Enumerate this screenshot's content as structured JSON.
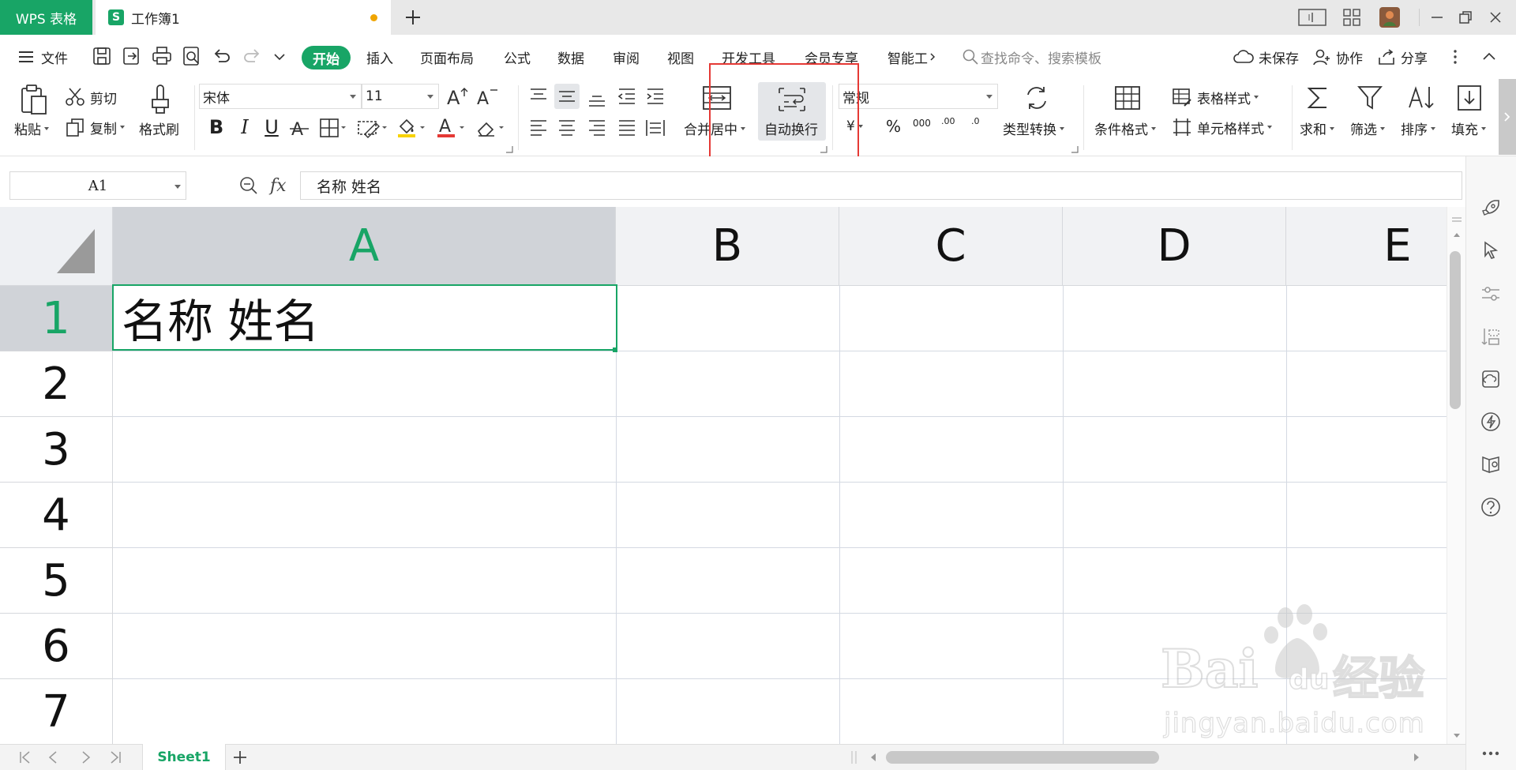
{
  "titlebar": {
    "app_tab": "WPS 表格",
    "doc_tab": "工作簿1",
    "doc_icon": "S"
  },
  "menu": {
    "file": "文件",
    "active": "开始",
    "items": [
      "插入",
      "页面布局",
      "公式",
      "数据",
      "审阅",
      "视图",
      "开发工具",
      "会员专享",
      "智能工"
    ],
    "search_placeholder": "查找命令、搜索模板",
    "unsaved": "未保存",
    "collaborate": "协作",
    "share": "分享"
  },
  "ribbon": {
    "paste": "粘贴",
    "cut": "剪切",
    "copy": "复制",
    "format_painter": "格式刷",
    "font_name": "宋体",
    "font_size": "11",
    "merge_center": "合并居中",
    "wrap_text": "自动换行",
    "number_format": "常规",
    "currency": "¥",
    "percent": "%",
    "thousands": "000",
    "inc_decimal": ".00",
    "dec_decimal": ".0",
    "type_convert": "类型转换",
    "conditional_format": "条件格式",
    "table_style": "表格样式",
    "cell_style": "单元格样式",
    "sum": "求和",
    "filter": "筛选",
    "sort": "排序",
    "fill": "填充",
    "bold": "B",
    "italic": "I",
    "underline": "U",
    "font_color_letter": "A"
  },
  "formula_bar": {
    "cell_ref": "A1",
    "fx": "fx",
    "content": "名称  姓名"
  },
  "sheet": {
    "columns": [
      "A",
      "B",
      "C",
      "D",
      "E"
    ],
    "rows": [
      "1",
      "2",
      "3",
      "4",
      "5",
      "6",
      "7"
    ],
    "cell_a1": "名称  姓名",
    "tab": "Sheet1"
  },
  "watermark": {
    "brand": "Bai",
    "brand_tail": "du",
    "cn": "经验",
    "url": "jingyan.baidu.com"
  },
  "colors": {
    "accent": "#18a566",
    "highlight": "#e53935",
    "selected_header": "#d0d3d8"
  }
}
